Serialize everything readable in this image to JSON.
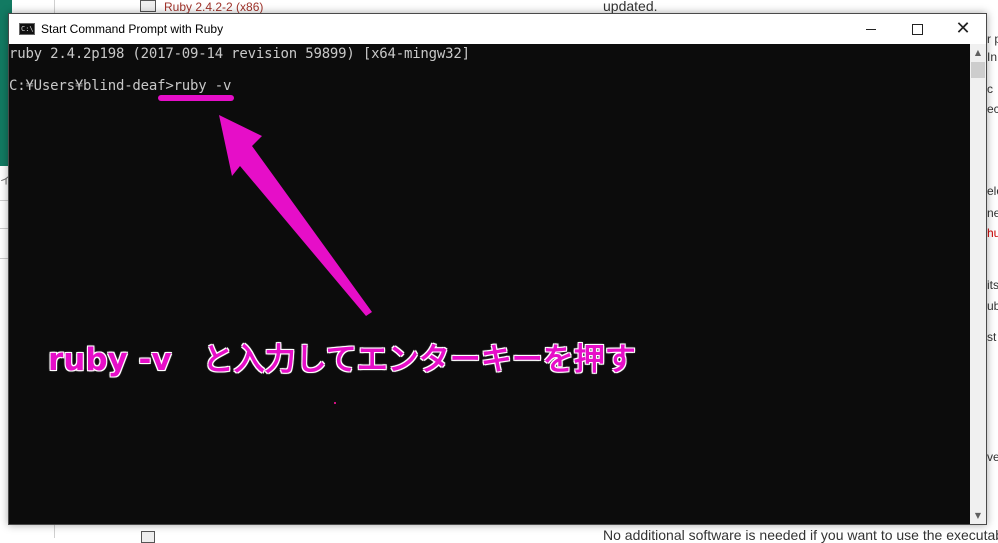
{
  "background_page": {
    "top_item": "Ruby 2.4.2-2 (x86)",
    "top_right_text": "updated.",
    "bottom_text": "No additional software is needed if you want to use the executab",
    "right_edge_fragments": [
      "r p",
      "In",
      "c",
      "ec",
      "elo",
      "ne",
      "hu",
      "its",
      "ub",
      "st",
      "ve"
    ],
    "left_edge_fragment": "イ"
  },
  "window": {
    "title": "Start Command Prompt with Ruby",
    "icon_label": "C:\\",
    "minimize_label": "",
    "maximize_label": "",
    "close_label": "✕"
  },
  "console": {
    "line1": "ruby 2.4.2p198 (2017-09-14 revision 59899) [x64-mingw32]",
    "line2": "C:¥Users¥blind-deaf>ruby -v"
  },
  "scrollbar": {
    "up_arrow": "▲",
    "down_arrow": "▼"
  },
  "annotation": {
    "instruction": "ruby -v　と入力してエンターキーを押す",
    "color": "#e60ec8"
  }
}
